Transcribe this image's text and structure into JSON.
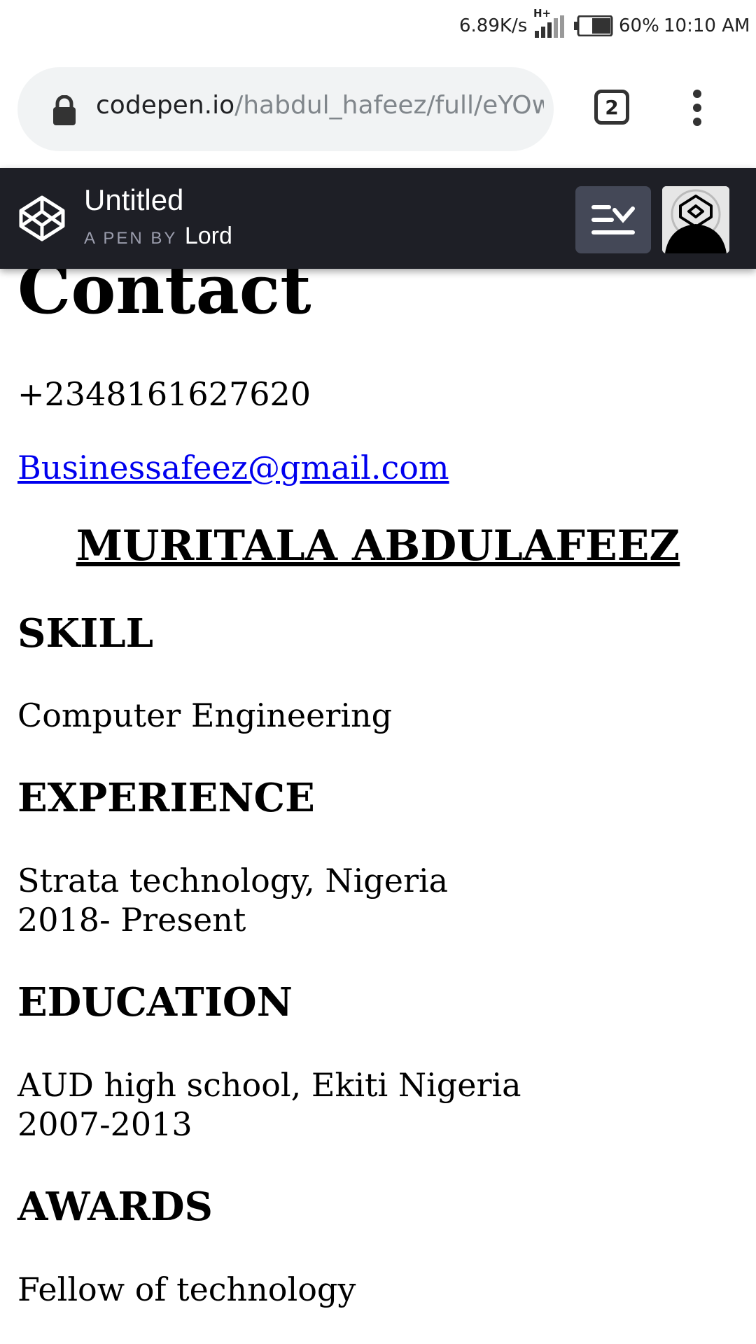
{
  "status_bar": {
    "speed": "6.89K/s",
    "network_type": "H+",
    "battery_percent": "60%",
    "time": "10:10 AM"
  },
  "browser": {
    "url_domain": "codepen.io",
    "url_path": "/habdul_hafeez/full/eYOwWc",
    "tab_count": "2"
  },
  "pen_header": {
    "title": "Untitled",
    "by_prefix": "A PEN BY",
    "author": "Lord"
  },
  "page": {
    "contact_heading": "Contact",
    "phone": "+2348161627620",
    "email": "Businessafeez@gmail.com",
    "name": "MURITALA ABDULAFEEZ",
    "skill_heading": "SKILL",
    "skill_text": "Computer Engineering",
    "experience_heading": "EXPERIENCE",
    "experience_line1": "Strata technology, Nigeria",
    "experience_line2": "2018- Present",
    "education_heading": "EDUCATION",
    "education_line1": "AUD high school, Ekiti Nigeria",
    "education_line2": "2007-2013",
    "awards_heading": "AWARDS",
    "awards_text": "Fellow of technology"
  },
  "colors": {
    "pen_header_bg": "#1e1f26",
    "toggle_button_bg": "#444857",
    "link": "#0000ee",
    "url_pill_bg": "#f1f3f4"
  }
}
